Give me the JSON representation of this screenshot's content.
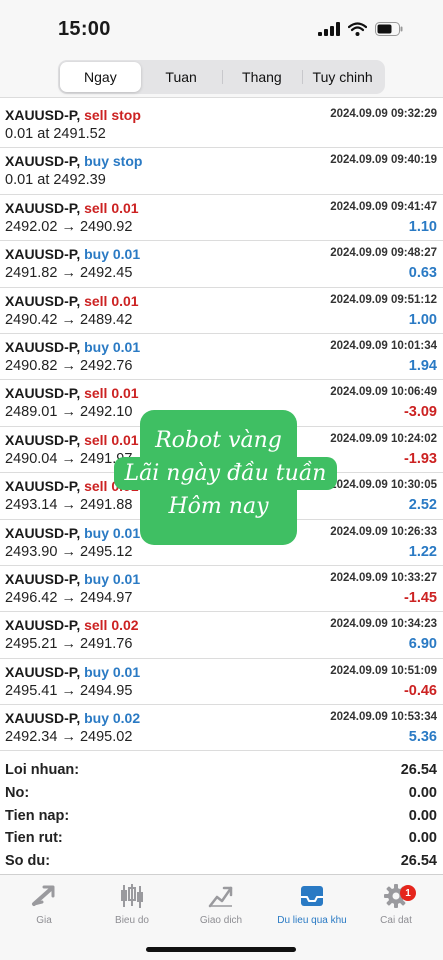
{
  "status_bar": {
    "time": "15:00"
  },
  "period_tabs": [
    {
      "label": "Ngay",
      "active": true
    },
    {
      "label": "Tuan",
      "active": false
    },
    {
      "label": "Thang",
      "active": false
    },
    {
      "label": "Tuy chinh",
      "active": false
    }
  ],
  "orders": [
    {
      "symbol": "XAUUSD-P,",
      "action": "sell stop",
      "side": "sell",
      "time": "2024.09.09 09:32:29",
      "detail": "0.01 at 2491.52",
      "profit": ""
    },
    {
      "symbol": "XAUUSD-P,",
      "action": "buy stop",
      "side": "buy",
      "time": "2024.09.09 09:40:19",
      "detail": "0.01 at 2492.39",
      "profit": ""
    },
    {
      "symbol": "XAUUSD-P,",
      "action": "sell 0.01",
      "side": "sell",
      "time": "2024.09.09 09:41:47",
      "detail": "2492.02 → 2490.92",
      "profit": "1.10"
    },
    {
      "symbol": "XAUUSD-P,",
      "action": "buy 0.01",
      "side": "buy",
      "time": "2024.09.09 09:48:27",
      "detail": "2491.82 → 2492.45",
      "profit": "0.63"
    },
    {
      "symbol": "XAUUSD-P,",
      "action": "sell 0.01",
      "side": "sell",
      "time": "2024.09.09 09:51:12",
      "detail": "2490.42 → 2489.42",
      "profit": "1.00"
    },
    {
      "symbol": "XAUUSD-P,",
      "action": "buy 0.01",
      "side": "buy",
      "time": "2024.09.09 10:01:34",
      "detail": "2490.82 → 2492.76",
      "profit": "1.94"
    },
    {
      "symbol": "XAUUSD-P,",
      "action": "sell 0.01",
      "side": "sell",
      "time": "2024.09.09 10:06:49",
      "detail": "2489.01 → 2492.10",
      "profit": "-3.09"
    },
    {
      "symbol": "XAUUSD-P,",
      "action": "sell 0.01",
      "side": "sell",
      "time": "2024.09.09 10:24:02",
      "detail": "2490.04 → 2491.97",
      "profit": "-1.93"
    },
    {
      "symbol": "XAUUSD-P,",
      "action": "sell 0.01",
      "side": "sell",
      "time": "2024.09.09 10:30:05",
      "detail": "2493.14 → 2491.88",
      "profit": "2.52"
    },
    {
      "symbol": "XAUUSD-P,",
      "action": "buy 0.01",
      "side": "buy",
      "time": "2024.09.09 10:26:33",
      "detail": "2493.90 → 2495.12",
      "profit": "1.22"
    },
    {
      "symbol": "XAUUSD-P,",
      "action": "buy 0.01",
      "side": "buy",
      "time": "2024.09.09 10:33:27",
      "detail": "2496.42 → 2494.97",
      "profit": "-1.45"
    },
    {
      "symbol": "XAUUSD-P,",
      "action": "sell 0.02",
      "side": "sell",
      "time": "2024.09.09 10:34:23",
      "detail": "2495.21 → 2491.76",
      "profit": "6.90"
    },
    {
      "symbol": "XAUUSD-P,",
      "action": "buy 0.01",
      "side": "buy",
      "time": "2024.09.09 10:51:09",
      "detail": "2495.41 → 2494.95",
      "profit": "-0.46"
    },
    {
      "symbol": "XAUUSD-P,",
      "action": "buy 0.02",
      "side": "buy",
      "time": "2024.09.09 10:53:34",
      "detail": "2492.34 → 2495.02",
      "profit": "5.36"
    }
  ],
  "summary": [
    {
      "label": "Loi nhuan:",
      "value": "26.54"
    },
    {
      "label": "No:",
      "value": "0.00"
    },
    {
      "label": "Tien nap:",
      "value": "0.00"
    },
    {
      "label": "Tien rut:",
      "value": "0.00"
    },
    {
      "label": "So du:",
      "value": "26.54"
    }
  ],
  "overlay_text": {
    "line1": "Robot vàng",
    "line2": "Lãi ngày đầu tuần",
    "line3": "Hôm nay"
  },
  "tab_bar": [
    {
      "label": "Gia",
      "icon": "trend-arrow-icon",
      "active": false
    },
    {
      "label": "Bieu do",
      "icon": "candlestick-icon",
      "active": false
    },
    {
      "label": "Giao dich",
      "icon": "trade-chart-icon",
      "active": false
    },
    {
      "label": "Du lieu qua khu",
      "icon": "inbox-history-icon",
      "active": true
    },
    {
      "label": "Cai dat",
      "icon": "gear-icon",
      "active": false,
      "badge": "1"
    }
  ],
  "colors": {
    "sell": "#cc2222",
    "buy": "#2a7ac4",
    "overlay": "#3fbf63",
    "active_tab": "#2a7ac4"
  }
}
